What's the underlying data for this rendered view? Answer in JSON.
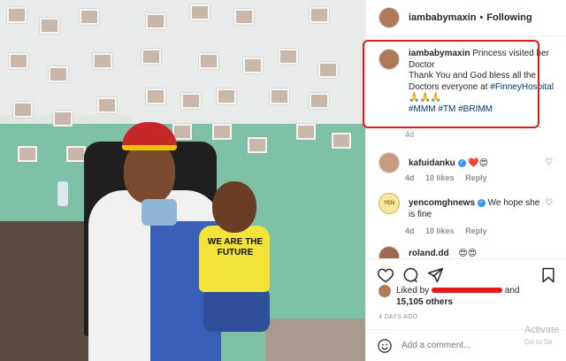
{
  "post": {
    "username": "iambabymaxin",
    "follow_label": "Following",
    "separator": "•"
  },
  "photo": {
    "shirt_text": "WE ARE THE FUTURE"
  },
  "caption": {
    "username": "iambabymaxin",
    "text_part1": "Princess visited her Doctor",
    "text_part2": "Thank You and God bless all the Doctors everyone at ",
    "mention": "#FinneyHospital",
    "emojis": "🙏🙏🙏",
    "hashtags": "#MMM #TM #BRIMM",
    "time": "4d"
  },
  "comments": [
    {
      "username": "kafuidanku",
      "verified": true,
      "text": "❤️😍",
      "time": "4d",
      "likes": "10 likes",
      "reply": "Reply"
    },
    {
      "username": "yencomghnews",
      "verified": true,
      "text": "We hope she is fine",
      "time": "4d",
      "likes": "10 likes",
      "reply": "Reply",
      "avatar_text": "YEN"
    },
    {
      "username": "roland.dd",
      "verified": false,
      "text": "😍😍"
    }
  ],
  "likes": {
    "prefix": "Liked by",
    "suffix": "and",
    "count": "15,105 others"
  },
  "date": "4 DAYS AGO",
  "comment_placeholder": "Add a comment...",
  "watermark": {
    "line1": "Activate",
    "line2": "Go to Se"
  },
  "icons": [
    "heart-icon",
    "comment-icon",
    "share-icon",
    "bookmark-icon",
    "emoji-icon"
  ],
  "colors": {
    "highlight_border": "#e31a1a",
    "link": "#00376b",
    "muted": "#8e8e8e"
  }
}
